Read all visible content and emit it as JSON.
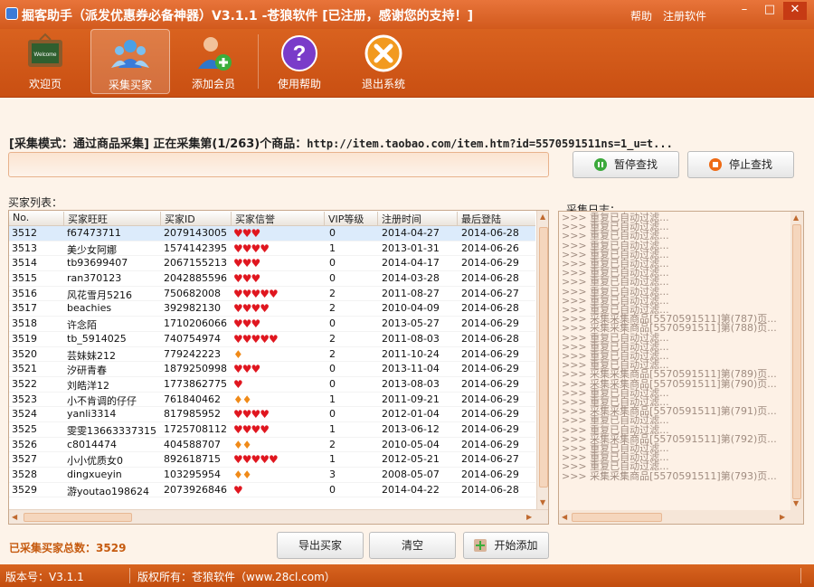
{
  "window": {
    "title": "掘客助手（派发优惠券必备神器）V3.1.1 -苍狼软件 [已注册，感谢您的支持！]",
    "help_link": "帮助",
    "register_link": "注册软件"
  },
  "toolbar": {
    "items": [
      {
        "label": "欢迎页",
        "icon": "welcome-board-icon"
      },
      {
        "label": "采集买家",
        "icon": "users-group-icon"
      },
      {
        "label": "添加会员",
        "icon": "add-user-icon"
      },
      {
        "label": "使用帮助",
        "icon": "help-question-icon"
      },
      {
        "label": "退出系统",
        "icon": "exit-icon"
      }
    ]
  },
  "collect": {
    "mode_text": "[采集模式：通过商品采集] 正在采集第(1/263)个商品：",
    "url": "http://item.taobao.com/item.htm?id=5570591511ns=1_u=t..."
  },
  "buttons": {
    "pause": "暂停查找",
    "stop": "停止查找",
    "export": "导出买家",
    "clear": "清空",
    "start_add": "开始添加"
  },
  "buyer_list": {
    "label": "买家列表：",
    "columns": [
      "No.",
      "买家旺旺",
      "买家ID",
      "买家信誉",
      "VIP等级",
      "注册时间",
      "最后登陆"
    ],
    "rows": [
      {
        "no": "3512",
        "name": "f67473711",
        "id": "2079143005",
        "rep": "♥♥♥",
        "rep_type": "heart",
        "vip": "0",
        "reg": "2014-04-27",
        "last": "2014-06-28"
      },
      {
        "no": "3513",
        "name": "美少女阿娜",
        "id": "1574142395",
        "rep": "♥♥♥♥",
        "rep_type": "heart",
        "vip": "1",
        "reg": "2013-01-31",
        "last": "2014-06-26"
      },
      {
        "no": "3514",
        "name": "tb93699407",
        "id": "2067155213",
        "rep": "♥♥♥",
        "rep_type": "heart",
        "vip": "0",
        "reg": "2014-04-17",
        "last": "2014-06-29"
      },
      {
        "no": "3515",
        "name": "ran370123",
        "id": "2042885596",
        "rep": "♥♥♥",
        "rep_type": "heart",
        "vip": "0",
        "reg": "2014-03-28",
        "last": "2014-06-28"
      },
      {
        "no": "3516",
        "name": "风花雪月5216",
        "id": "750682008",
        "rep": "♥♥♥♥♥",
        "rep_type": "heart",
        "vip": "2",
        "reg": "2011-08-27",
        "last": "2014-06-27"
      },
      {
        "no": "3517",
        "name": "beachies",
        "id": "392982130",
        "rep": "♥♥♥♥",
        "rep_type": "heart",
        "vip": "2",
        "reg": "2010-04-09",
        "last": "2014-06-28"
      },
      {
        "no": "3518",
        "name": "许念陌",
        "id": "1710206066",
        "rep": "♥♥♥",
        "rep_type": "heart",
        "vip": "0",
        "reg": "2013-05-27",
        "last": "2014-06-29"
      },
      {
        "no": "3519",
        "name": "tb_5914025",
        "id": "740754974",
        "rep": "♥♥♥♥♥",
        "rep_type": "heart",
        "vip": "2",
        "reg": "2011-08-03",
        "last": "2014-06-28"
      },
      {
        "no": "3520",
        "name": "芸妹妹212",
        "id": "779242223",
        "rep": "♦",
        "rep_type": "diamond",
        "vip": "2",
        "reg": "2011-10-24",
        "last": "2014-06-29"
      },
      {
        "no": "3521",
        "name": "汐研青春",
        "id": "1879250998",
        "rep": "♥♥♥",
        "rep_type": "heart",
        "vip": "0",
        "reg": "2013-11-04",
        "last": "2014-06-29"
      },
      {
        "no": "3522",
        "name": "刘皓洋12",
        "id": "1773862775",
        "rep": "♥",
        "rep_type": "heart",
        "vip": "0",
        "reg": "2013-08-03",
        "last": "2014-06-29"
      },
      {
        "no": "3523",
        "name": "小不肯调的仔仔",
        "id": "761840462",
        "rep": "♦♦",
        "rep_type": "diamond",
        "vip": "1",
        "reg": "2011-09-21",
        "last": "2014-06-29"
      },
      {
        "no": "3524",
        "name": "yanli3314",
        "id": "817985952",
        "rep": "♥♥♥♥",
        "rep_type": "heart",
        "vip": "0",
        "reg": "2012-01-04",
        "last": "2014-06-29"
      },
      {
        "no": "3525",
        "name": "雯雯13663337315",
        "id": "1725708112",
        "rep": "♥♥♥♥",
        "rep_type": "heart",
        "vip": "1",
        "reg": "2013-06-12",
        "last": "2014-06-29"
      },
      {
        "no": "3526",
        "name": "c8014474",
        "id": "404588707",
        "rep": "♦♦",
        "rep_type": "diamond",
        "vip": "2",
        "reg": "2010-05-04",
        "last": "2014-06-29"
      },
      {
        "no": "3527",
        "name": "小小优质女0",
        "id": "892618715",
        "rep": "♥♥♥♥♥",
        "rep_type": "heart",
        "vip": "1",
        "reg": "2012-05-21",
        "last": "2014-06-27"
      },
      {
        "no": "3528",
        "name": "dingxueyin",
        "id": "103295954",
        "rep": "♦♦",
        "rep_type": "diamond",
        "vip": "3",
        "reg": "2008-05-07",
        "last": "2014-06-29"
      },
      {
        "no": "3529",
        "name": "游youtao198624",
        "id": "2073926846",
        "rep": "♥",
        "rep_type": "heart",
        "vip": "0",
        "reg": "2014-04-22",
        "last": "2014-06-28"
      }
    ]
  },
  "log": {
    "label": "采集日志：",
    "lines": [
      ">>> 重复已自动过滤...",
      ">>> 重复已自动过滤...",
      ">>> 重复已自动过滤...",
      ">>> 重复已自动过滤...",
      ">>> 重复已自动过滤...",
      ">>> 重复已自动过滤...",
      ">>> 重复已自动过滤...",
      ">>> 重复已自动过滤...",
      ">>> 重复已自动过滤...",
      ">>> 重复已自动过滤...",
      ">>> 重复已自动过滤...",
      ">>> 采集采集商品[5570591511]第(787)页...",
      ">>> 采集采集商品[5570591511]第(788)页...",
      ">>> 重复已自动过滤...",
      ">>> 重复已自动过滤...",
      ">>> 重复已自动过滤...",
      ">>> 重复已自动过滤...",
      ">>> 采集采集商品[5570591511]第(789)页...",
      ">>> 采集采集商品[5570591511]第(790)页...",
      ">>> 重复已自动过滤...",
      ">>> 重复已自动过滤...",
      ">>> 采集采集商品[5570591511]第(791)页...",
      ">>> 重复已自动过滤...",
      ">>> 重复已自动过滤...",
      ">>> 采集采集商品[5570591511]第(792)页...",
      ">>> 重复已自动过滤...",
      ">>> 重复已自动过滤...",
      ">>> 重复已自动过滤...",
      ">>> 采集采集商品[5570591511]第(793)页..."
    ]
  },
  "summary": {
    "total_label": "已采集买家总数：",
    "total": "3529"
  },
  "status": {
    "version": "版本号：V3.1.1",
    "copyright": "版权所有：苍狼软件（www.28cl.com）"
  },
  "colors": {
    "brand_orange": "#d25a1d",
    "heart_red": "#e0161f",
    "diamond_orange": "#f08a18",
    "total_text": "#c65b10"
  }
}
